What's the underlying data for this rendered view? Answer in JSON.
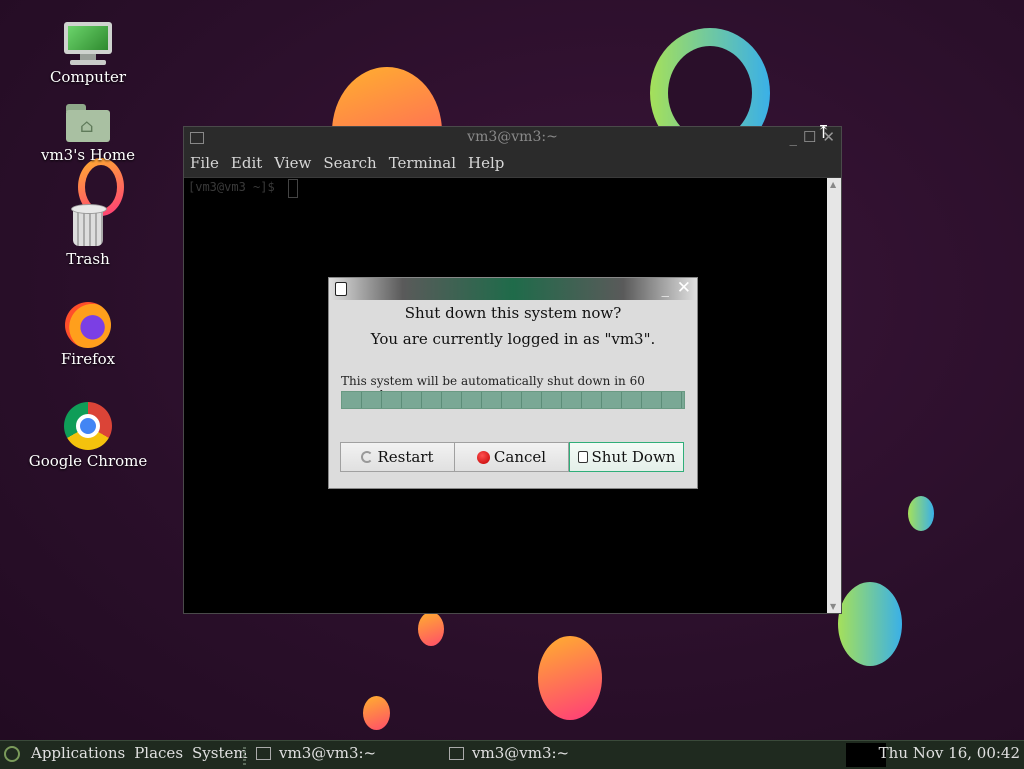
{
  "desktop_icons": [
    {
      "label": "Computer",
      "icon": "computer-icon"
    },
    {
      "label": "vm3's Home",
      "icon": "home-folder-icon"
    },
    {
      "label": "Trash",
      "icon": "trash-icon"
    },
    {
      "label": "Firefox",
      "icon": "firefox-icon"
    },
    {
      "label": "Google Chrome",
      "icon": "chrome-icon"
    }
  ],
  "terminal": {
    "title": "vm3@vm3:~",
    "menu": [
      "File",
      "Edit",
      "View",
      "Search",
      "Terminal",
      "Help"
    ],
    "prompt": "[vm3@vm3 ~]$",
    "window_buttons": [
      "_",
      "☐",
      "✕"
    ]
  },
  "dialog": {
    "question": "Shut down this system now?",
    "logged_in": "You are currently logged in as \"vm3\".",
    "auto_text": "This system will be automatically shut down in 60 seconds",
    "progress": 1.0,
    "buttons": {
      "restart": "Restart",
      "cancel": "Cancel",
      "shutdown": "Shut Down"
    },
    "minimize": "_",
    "close": "✕"
  },
  "panel": {
    "menus": [
      "Applications",
      "Places",
      "System"
    ],
    "tasks": [
      "vm3@vm3:~",
      "vm3@vm3:~"
    ],
    "clock": "Thu Nov 16, 00:42"
  },
  "colors": {
    "desktop_bg": "#2a0f2a",
    "panel_bg": "#1f2a1f",
    "progress": "#7aa895",
    "primary_border": "#2fae79"
  }
}
